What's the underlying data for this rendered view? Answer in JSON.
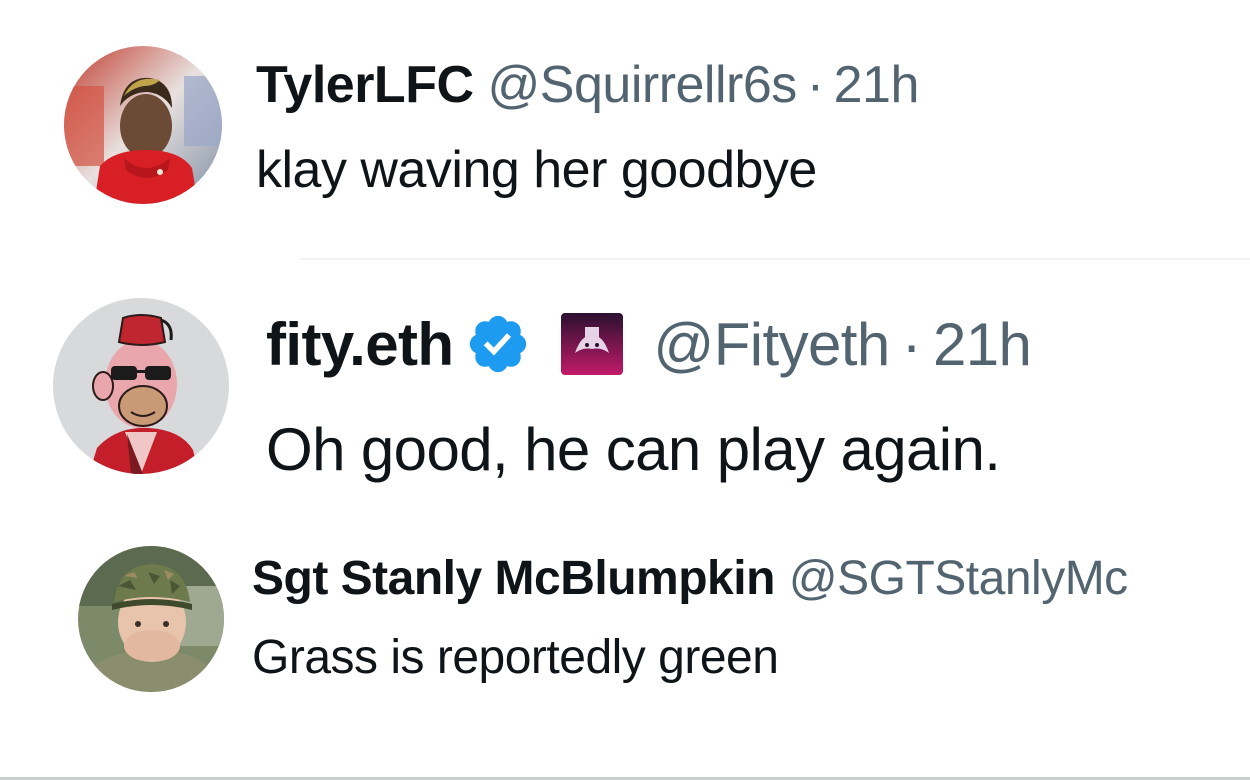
{
  "tweets": [
    {
      "display_name": "TylerLFC",
      "handle": "@Squirrellr6s",
      "separator": "·",
      "time": "21h",
      "text": "klay waving her goodbye",
      "avatar_icon": "red-hoodie-person-avatar"
    },
    {
      "display_name": "fity.eth",
      "verified": true,
      "verified_icon": "verified-badge-icon",
      "affiliate_icon": "affiliate-badge-icon",
      "handle": "@Fityeth",
      "separator": "·",
      "time": "21h",
      "text": "Oh good, he can play again.",
      "avatar_icon": "bored-ape-nft-avatar"
    },
    {
      "display_name": "Sgt Stanly McBlumpkin",
      "handle": "@SGTStanlyMc",
      "text": "Grass is reportedly green",
      "avatar_icon": "camo-cap-person-avatar"
    }
  ],
  "colors": {
    "text_primary": "#0f1419",
    "text_secondary": "#536471",
    "verified_blue": "#1d9bf0",
    "divider": "#eff3f4",
    "background": "#ffffff"
  }
}
